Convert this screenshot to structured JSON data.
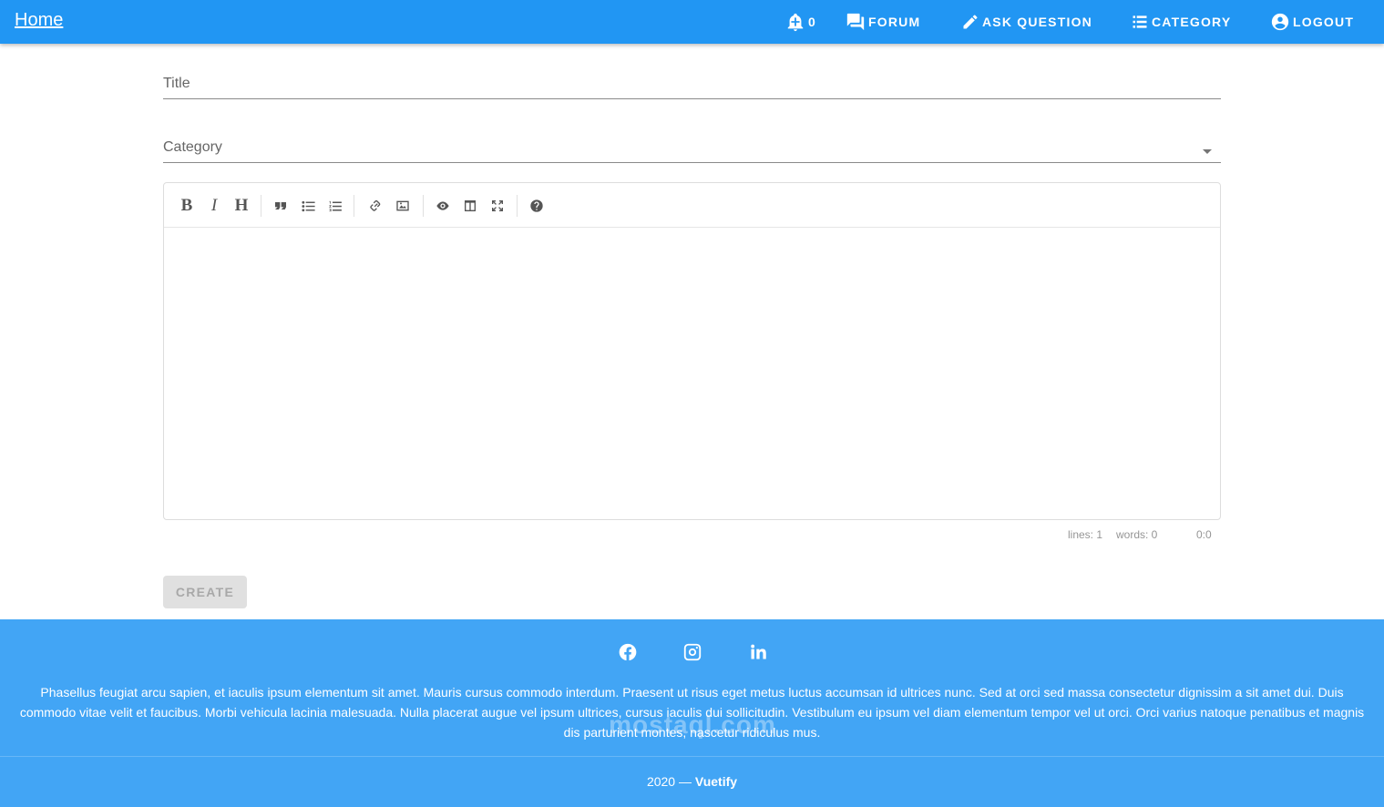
{
  "appbar": {
    "brand": "Home",
    "notifications_count": "0",
    "forum_label": "FORUM",
    "ask_label": "ASK QUESTION",
    "category_label": "CATEGORY",
    "logout_label": "LOGOUT",
    "color": "#2196F3"
  },
  "form": {
    "title_label": "Title",
    "title_value": "",
    "category_label": "Category",
    "category_value": "",
    "editor": {
      "tools": [
        "bold-icon",
        "italic-icon",
        "heading-icon",
        "quote-icon",
        "unordered-list-icon",
        "ordered-list-icon",
        "link-icon",
        "image-icon",
        "preview-icon",
        "side-by-side-icon",
        "fullscreen-icon",
        "help-icon"
      ],
      "bold_glyph": "B",
      "italic_glyph": "I",
      "heading_glyph": "H",
      "content": "",
      "status_lines": "lines: 1",
      "status_words": "words: 0",
      "status_cursor": "0:0"
    },
    "create_label": "CREATE"
  },
  "footer": {
    "color": "#42A5F5",
    "social": [
      "facebook-icon",
      "instagram-icon",
      "linkedin-icon"
    ],
    "text": "Phasellus feugiat arcu sapien, et iaculis ipsum elementum sit amet. Mauris cursus commodo interdum. Praesent ut risus eget metus luctus accumsan id ultrices nunc. Sed at orci sed massa consectetur dignissim a sit amet dui. Duis commodo vitae velit et faucibus. Morbi vehicula lacinia malesuada. Nulla placerat augue vel ipsum ultrices, cursus iaculis dui sollicitudin. Vestibulum eu ipsum vel diam elementum tempor vel ut orci. Orci varius natoque penatibus et magnis dis parturient montes, nascetur ridiculus mus.",
    "year": "2020 — ",
    "brand": "Vuetify",
    "watermark": "mostaql.com"
  }
}
